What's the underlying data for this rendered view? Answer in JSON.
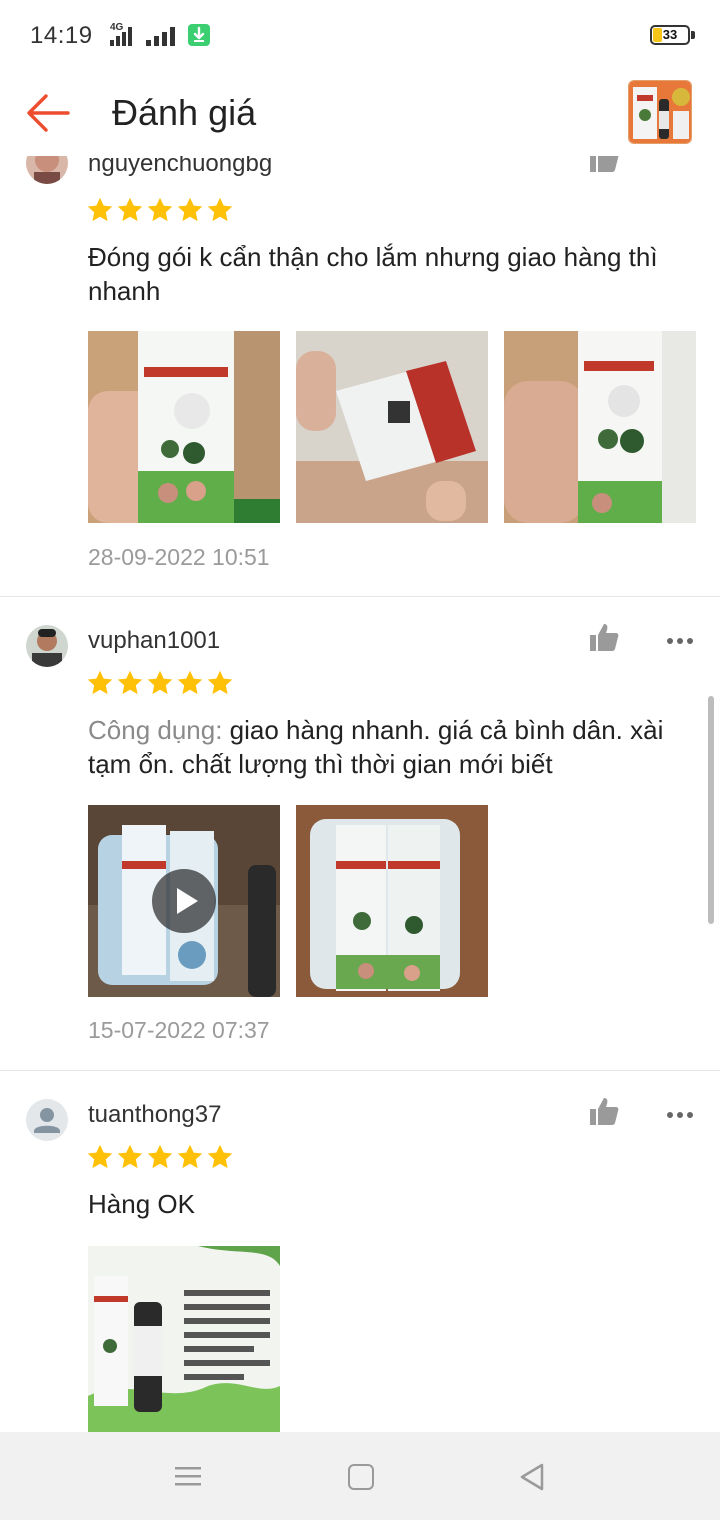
{
  "status_bar": {
    "time": "14:19",
    "network": "4G",
    "battery": "33"
  },
  "header": {
    "title": "Đánh giá"
  },
  "reviews": [
    {
      "username": "nguyenchuongbg",
      "rating": 5,
      "comment": "Đóng gói k cẩn thận cho lắm nhưng giao hàng thì nhanh",
      "date": "28-09-2022 10:51",
      "photo_count": 3
    },
    {
      "username": "vuphan1001",
      "rating": 5,
      "comment_label": "Công dụng:",
      "comment": " giao hàng nhanh. giá cả bình dân. xài tạm ổn. chất lượng thì thời gian mới biết",
      "date": "15-07-2022 07:37",
      "photo_count": 2,
      "has_video": true
    },
    {
      "username": "tuanthong37",
      "rating": 5,
      "comment": "Hàng OK",
      "photo_count": 1
    }
  ],
  "colors": {
    "accent": "#ee4d2d",
    "star": "#ffc107",
    "muted_text": "#9a9a9a",
    "divider": "#e6e6e6"
  },
  "icons": [
    "back-arrow-icon",
    "thumbs-up-icon",
    "more-icon",
    "star-icon",
    "play-icon",
    "menu-nav-icon",
    "home-nav-icon",
    "back-nav-icon"
  ]
}
